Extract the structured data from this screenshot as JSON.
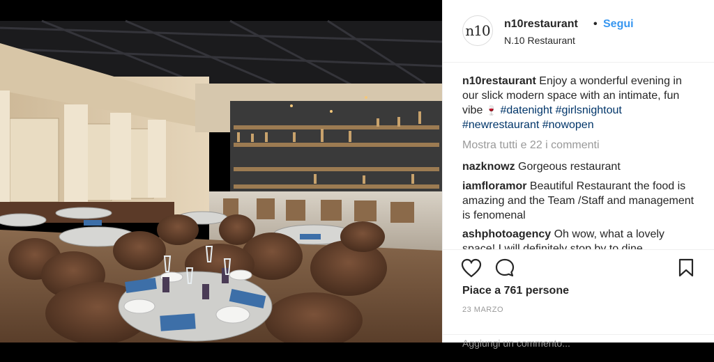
{
  "post": {
    "username": "n10restaurant",
    "dot": "•",
    "follow_label": "Segui",
    "location": "N.10 Restaurant",
    "avatar_text": "n10"
  },
  "caption": {
    "user": "n10restaurant",
    "text": "Enjoy a wonderful evening in our slick modern space with an intimate, fun vibe",
    "emoji": "🍷",
    "hashtags": [
      "#datenight",
      "#girlsnightout",
      "#newrestaurant",
      "#nowopen"
    ]
  },
  "view_all_comments": "Mostra tutti e 22 i commenti",
  "comments": [
    {
      "user": "nazknowz",
      "text": "Gorgeous restaurant"
    },
    {
      "user": "iamfloramor",
      "text": "Beautiful Restaurant the food is amazing and the Team /Staff and management is fenomenal"
    },
    {
      "user": "ashphotoagency",
      "text": "Oh wow, what a lovely space! I will definitely stop by to dine"
    }
  ],
  "likes_text": "Piace a 761 persone",
  "date_text": "23 MARZO",
  "add_comment_placeholder": "Aggiungi un commento...",
  "icons": [
    "heart-icon",
    "comment-icon",
    "bookmark-icon"
  ]
}
